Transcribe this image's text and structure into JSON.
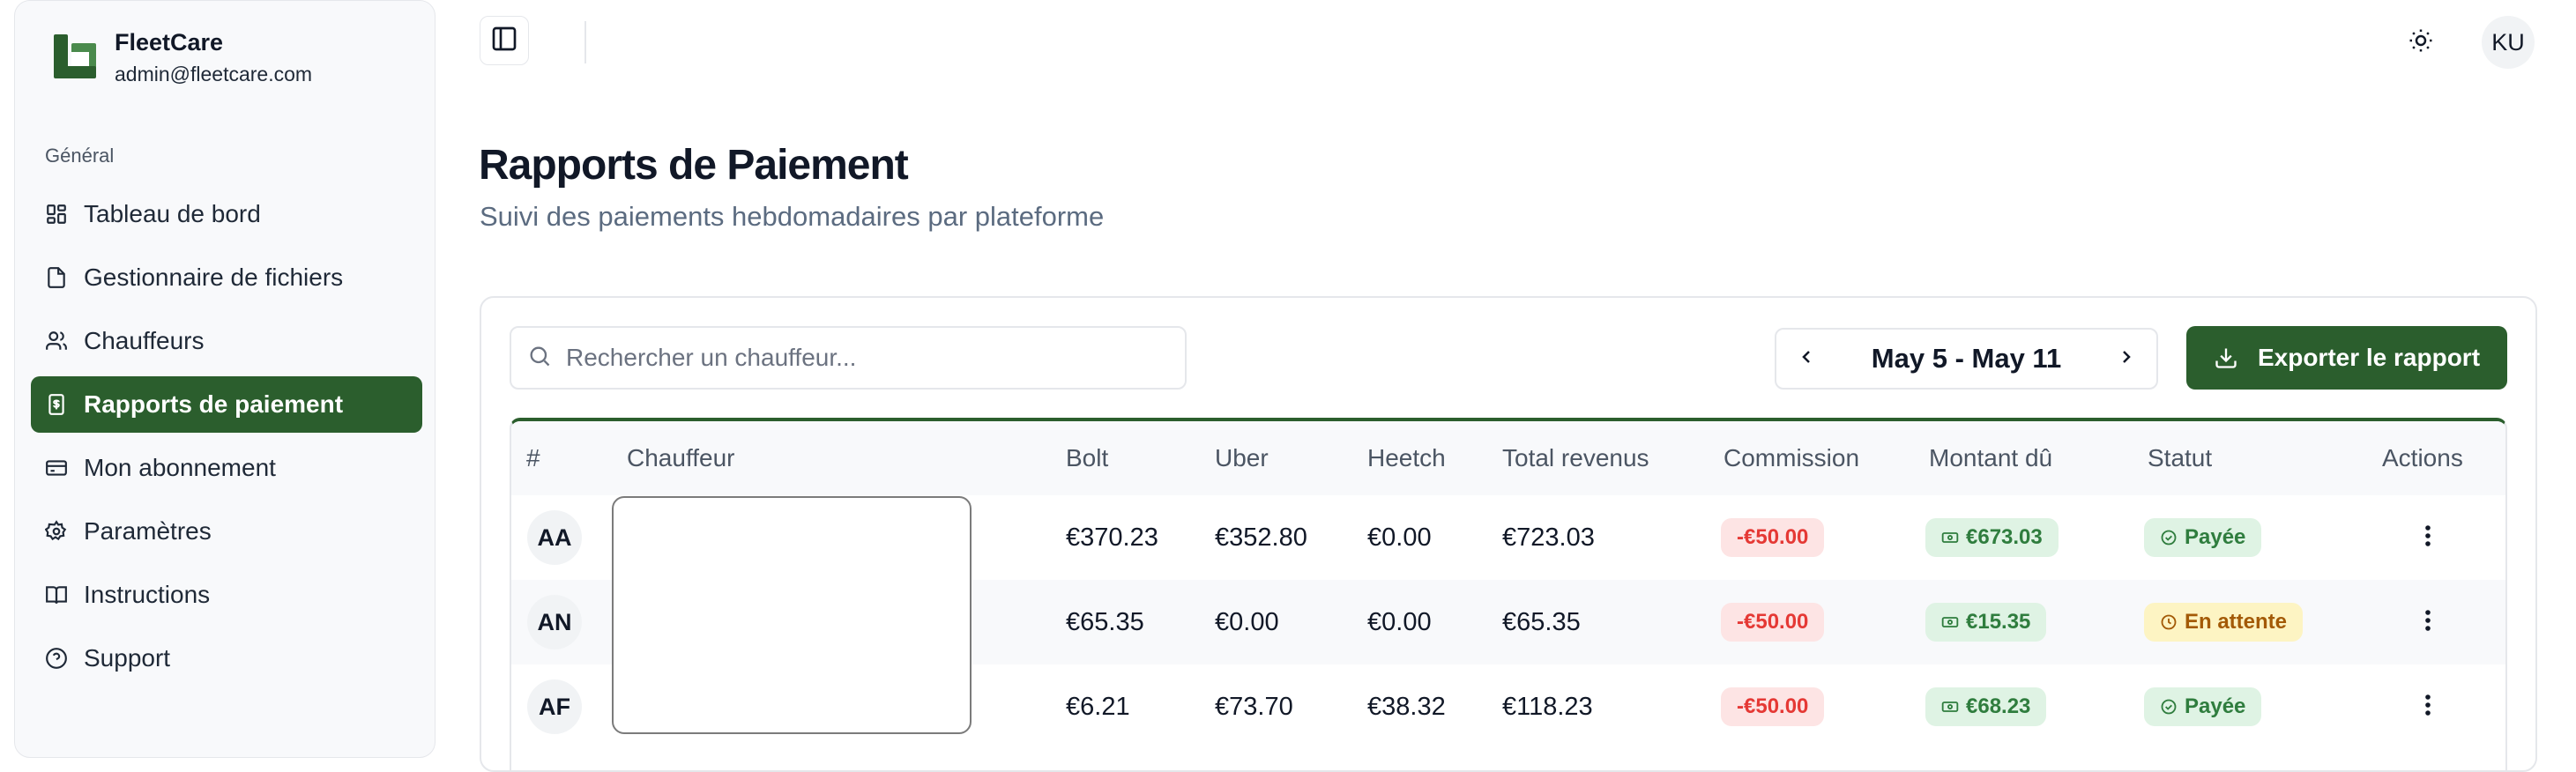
{
  "brand": {
    "name": "FleetCare",
    "email": "admin@fleetcare.com"
  },
  "sidebar": {
    "section": "Général",
    "items": [
      {
        "label": "Tableau de bord",
        "icon": "dashboard-icon"
      },
      {
        "label": "Gestionnaire de fichiers",
        "icon": "file-icon"
      },
      {
        "label": "Chauffeurs",
        "icon": "users-icon"
      },
      {
        "label": "Rapports de paiement",
        "icon": "receipt-icon",
        "active": true
      },
      {
        "label": "Mon abonnement",
        "icon": "credit-card-icon"
      },
      {
        "label": "Paramètres",
        "icon": "gear-icon"
      },
      {
        "label": "Instructions",
        "icon": "book-icon"
      },
      {
        "label": "Support",
        "icon": "help-circle-icon"
      }
    ]
  },
  "topbar": {
    "user_initials": "KU"
  },
  "page": {
    "title": "Rapports de Paiement",
    "subtitle": "Suivi des paiements hebdomadaires par plateforme"
  },
  "toolbar": {
    "search_placeholder": "Rechercher un chauffeur...",
    "week_range": "May 5 - May 11",
    "export_label": "Exporter le rapport"
  },
  "table": {
    "headers": [
      "#",
      "Chauffeur",
      "Bolt",
      "Uber",
      "Heetch",
      "Total revenus",
      "Commission",
      "Montant dû",
      "Statut",
      "Actions"
    ],
    "rows": [
      {
        "initials": "AA",
        "bolt": "€370.23",
        "uber": "€352.80",
        "heetch": "€0.00",
        "total": "€723.03",
        "commission": "-€50.00",
        "due": "€673.03",
        "status": "Payée",
        "status_type": "paid"
      },
      {
        "initials": "AN",
        "bolt": "€65.35",
        "uber": "€0.00",
        "heetch": "€0.00",
        "total": "€65.35",
        "commission": "-€50.00",
        "due": "€15.35",
        "status": "En attente",
        "status_type": "pending"
      },
      {
        "initials": "AF",
        "bolt": "€6.21",
        "uber": "€73.70",
        "heetch": "€38.32",
        "total": "€118.23",
        "commission": "-€50.00",
        "due": "€68.23",
        "status": "Payée",
        "status_type": "paid"
      }
    ]
  },
  "colors": {
    "accent": "#2b5e2d",
    "negative": "#e53935",
    "positive": "#2f7d3e",
    "pending": "#a35a07"
  }
}
